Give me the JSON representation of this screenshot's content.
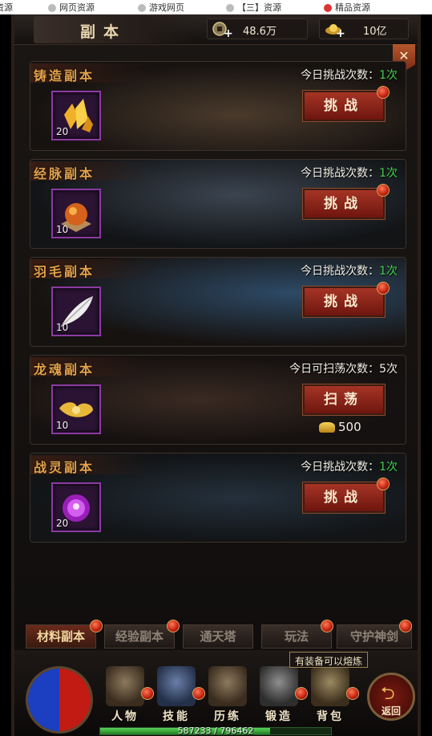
{
  "bookmarks": [
    "资源",
    "网页资源",
    "游戏网页",
    "【三】资源",
    "精品资源"
  ],
  "header": {
    "title": "副本",
    "copper_value": "48.6万",
    "gold_value": "10亿"
  },
  "dungeons": [
    {
      "name": "铸造副本",
      "label_prefix": "今日挑战次数：",
      "count": "1次",
      "button": "挑战",
      "item_count": "20",
      "item_icon": "gold-crystal-icon"
    },
    {
      "name": "经脉副本",
      "label_prefix": "今日挑战次数：",
      "count": "1次",
      "button": "挑战",
      "item_count": "10",
      "item_icon": "meridian-orb-icon"
    },
    {
      "name": "羽毛副本",
      "label_prefix": "今日挑战次数：",
      "count": "1次",
      "button": "挑战",
      "item_count": "10",
      "item_icon": "white-feather-icon"
    },
    {
      "name": "龙魂副本",
      "label_prefix": "今日可扫荡次数：",
      "count": "5次",
      "button": "扫荡",
      "item_count": "10",
      "item_icon": "dragon-soul-gold-icon",
      "cost": "500"
    },
    {
      "name": "战灵副本",
      "label_prefix": "今日挑战次数：",
      "count": "1次",
      "button": "挑战",
      "item_count": "20",
      "item_icon": "purple-spirit-orb-icon"
    }
  ],
  "tabs": [
    "材料副本",
    "经验副本",
    "通天塔",
    "玩法",
    "守护神剑"
  ],
  "bottom_nav": {
    "items": [
      "人物",
      "技能",
      "历练",
      "锻造",
      "背包"
    ],
    "return_label": "返回",
    "tip": "有装备可以熔炼",
    "xp_text": "587233 / 796462",
    "xp_fraction": 0.737
  },
  "colors": {
    "title_orange": "#e3a24a",
    "count_green": "#3fd64a",
    "button_red": "#a53425",
    "item_frame_purple": "#8b3ba3"
  }
}
